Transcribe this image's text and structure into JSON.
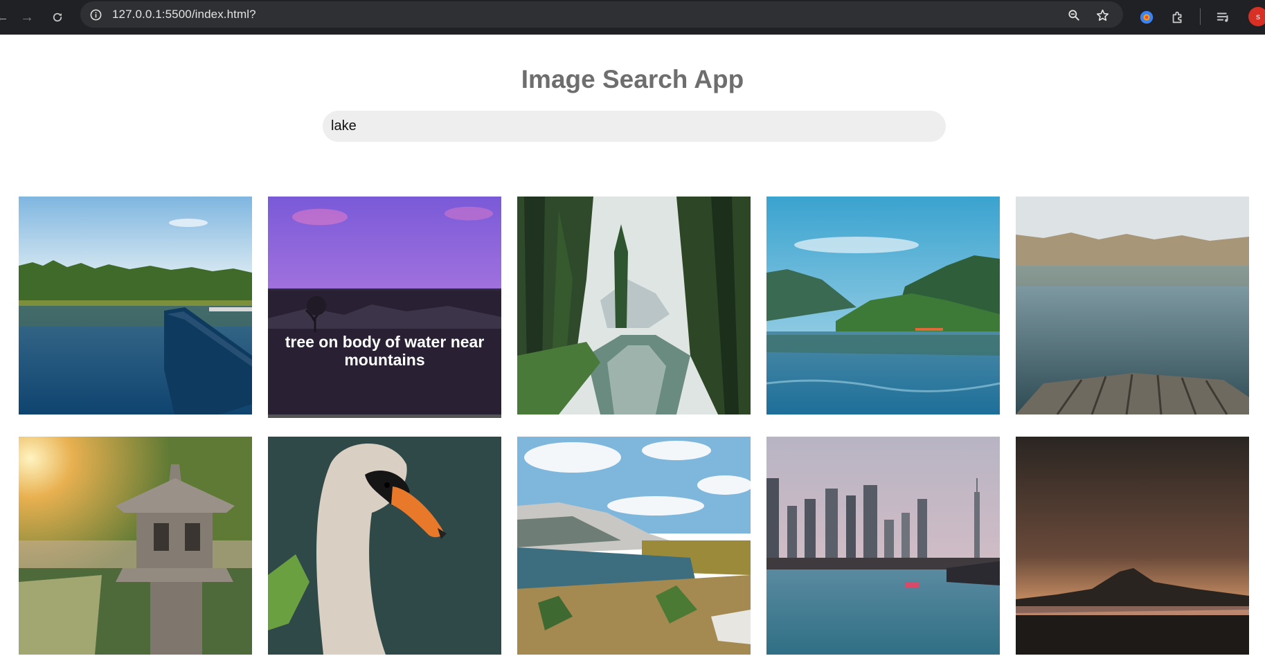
{
  "browser": {
    "url": "127.0.0.1:5500/index.html?",
    "profile_initial": "s",
    "icons": {
      "back": "arrow-left-icon",
      "forward": "arrow-right-icon",
      "reload": "reload-icon",
      "site_info": "info-icon",
      "zoom": "zoom-icon",
      "bookmark": "star-icon",
      "extension_1": "extension-icon",
      "extensions": "puzzle-icon",
      "media": "media-queue-icon"
    }
  },
  "page": {
    "title": "Image Search App",
    "search": {
      "value": "lake"
    },
    "results": [
      {
        "name": "lake-canoe",
        "caption": ""
      },
      {
        "name": "tree-in-water",
        "caption": "tree on body of water near mountains"
      },
      {
        "name": "forest-river",
        "caption": ""
      },
      {
        "name": "mountain-lake",
        "caption": ""
      },
      {
        "name": "lake-dock",
        "caption": ""
      },
      {
        "name": "stone-lantern",
        "caption": ""
      },
      {
        "name": "swan",
        "caption": ""
      },
      {
        "name": "alpine-lake",
        "caption": ""
      },
      {
        "name": "city-skyline-lake",
        "caption": ""
      },
      {
        "name": "sunset-mountain",
        "caption": ""
      }
    ]
  },
  "colors": {
    "chrome_bg": "#1f2125",
    "omnibox_bg": "#2e3033",
    "title": "#6e6e6e",
    "search_bg": "#eeeeee"
  }
}
